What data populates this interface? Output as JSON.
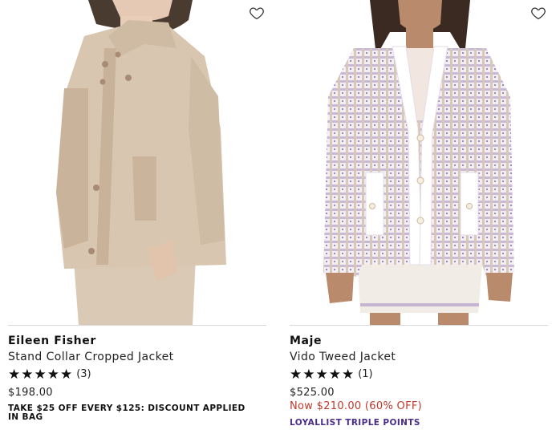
{
  "products": [
    {
      "brand": "Eileen Fisher",
      "name": "Stand Collar Cropped Jacket",
      "stars": "★★★★★",
      "review_count": "(3)",
      "price": "$198.00",
      "promo": "TAKE $25 OFF EVERY $125: DISCOUNT APPLIED IN BAG",
      "rating": 5,
      "image_icon": "product-photo-beige-jacket",
      "wishlist_icon": "heart-outline-icon"
    },
    {
      "brand": "Maje",
      "name": "Vido Tweed Jacket",
      "stars": "★★★★★",
      "review_count": "(1)",
      "price": "$525.00",
      "sale_price": "Now $210.00 (60% OFF)",
      "loyalty": "LOYALLIST TRIPLE POINTS",
      "rating": 5,
      "image_icon": "product-photo-tweed-jacket",
      "wishlist_icon": "heart-outline-icon"
    }
  ],
  "colors": {
    "sale": "#c0392b",
    "loyalty": "#4a2c8a",
    "text": "#222222"
  }
}
